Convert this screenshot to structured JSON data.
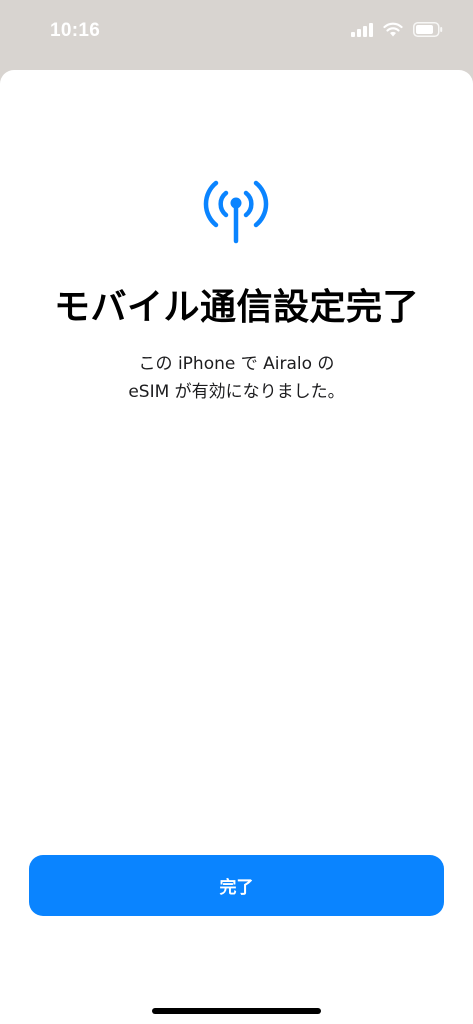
{
  "status_bar": {
    "time": "10:16",
    "icons": [
      "cellular-signal-icon",
      "wifi-icon",
      "battery-icon"
    ]
  },
  "sheet": {
    "icon": "antenna-signal-icon",
    "title": "モバイル通信設定完了",
    "subtitle_lines": [
      "この iPhone で Airalo の",
      "eSIM が有効になりました。"
    ],
    "done_button_label": "完了"
  },
  "colors": {
    "accent": "#0a84ff",
    "background_dim": "#d8d4d0",
    "sheet": "#ffffff"
  }
}
